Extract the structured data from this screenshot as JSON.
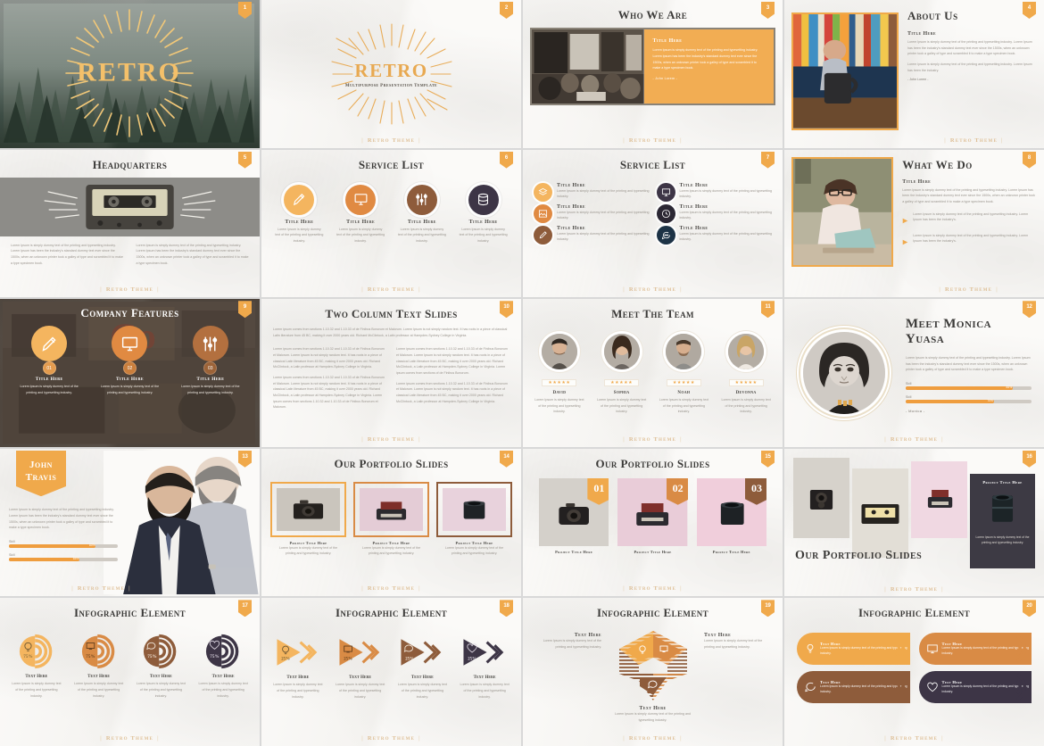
{
  "meta": {
    "watermark": "Retro Theme",
    "brand_orange": "#f0a94b",
    "brand_dark": "#3d3546",
    "brand_brown": "#8e5c3b",
    "brand_tan": "#d98b45"
  },
  "common": {
    "title_here": "Title Here",
    "text_here": "Text Here",
    "lorem_short": "Lorem Ipsum is simply dummy text of the printing and typesetting industry.",
    "lorem_medium": "Lorem Ipsum is simply dummy text of the printing and typesetting industry. Lorem Ipsum has been the industry's standard dummy text ever since the 1500s, when an unknown printer took a galley of type and scrambled it to make a type specimen book.",
    "lorem_long": "Lorem ipsum comes from sections 1.10.32 and 1.10.33 of de Finibus Bonorum et Malorum. Lorem Ipsum is not simply random text. It has roots in a piece of classical Latin literature from 45 BC, making it over 2000 years old. Richard McClintock, a Latin professor at Hampden-Sydney College in Virginia.",
    "signature": "- John Lorem -",
    "percent": "75%"
  },
  "slides": [
    {
      "number": "1",
      "name": "cover-slide",
      "title": "RETRO",
      "subtitle": ""
    },
    {
      "number": "2",
      "name": "cover-light-slide",
      "title": "RETRO",
      "subtitle": "Multipurpose Presentation Template"
    },
    {
      "number": "3",
      "name": "who-we-are-slide",
      "title": "Who We Are",
      "panel_title": "Title Here",
      "panel_body": "Lorem Ipsum is simply dummy text of the printing and typesetting industry. Lorem Ipsum has been the industry's standard dummy text ever since the 1500s, when an unknown printer took a galley of type and scrambled it to make a type specimen book.",
      "panel_sig": "- John Lorem -"
    },
    {
      "number": "4",
      "name": "about-us-slide",
      "title": "About Us",
      "body_title": "Title Here",
      "body_p1": "Lorem Ipsum is simply dummy text of the printing and typesetting industry. Lorem Ipsum has been the industry's standard dummy text ever since the 1500s, when an unknown printer took a galley of type and scrambled it to make a type specimen book.",
      "body_p2": "Lorem Ipsum is simply dummy text of the printing and typesetting industry. Lorem Ipsum has been the industry.",
      "body_sig": "- John Lorem -"
    },
    {
      "number": "5",
      "name": "headquarters-slide",
      "title": "Headquarters",
      "col1": "Lorem Ipsum is simply dummy text of the printing and typesetting industry. Lorem Ipsum has been the industry's standard dummy text ever since the 1500s, when an unknown printer took a galley of type and scrambled it to make a type specimen book.",
      "col2": "Lorem Ipsum is simply dummy text of the printing and typesetting industry. Lorem Ipsum has been the industry's standard dummy text ever since the 1500s, when an unknown printer took a galley of type and scrambled it to make a type specimen book."
    },
    {
      "number": "6",
      "name": "service-list-circles-slide",
      "title": "Service List",
      "items": [
        {
          "label": "Title Here",
          "icon": "pencil-icon",
          "color": "#f4b55f",
          "body": "Lorem Ipsum is simply dummy text of the printing and typesetting industry."
        },
        {
          "label": "Title Here",
          "icon": "monitor-icon",
          "color": "#e08a42",
          "body": "Lorem Ipsum is simply dummy text of the printing and typesetting industry."
        },
        {
          "label": "Title Here",
          "icon": "sliders-icon",
          "color": "#8e5c3b",
          "body": "Lorem Ipsum is simply dummy text of the printing and typesetting industry."
        },
        {
          "label": "Title Here",
          "icon": "database-icon",
          "color": "#3d3546",
          "body": "Lorem Ipsum is simply dummy text of the printing and typesetting industry."
        }
      ]
    },
    {
      "number": "7",
      "name": "service-list-two-column-slide",
      "title": "Service List",
      "items": [
        {
          "label": "Title Here",
          "icon": "layers-icon",
          "color": "#f4b55f",
          "body": "Lorem Ipsum is simply dummy text of the printing and typesetting industry."
        },
        {
          "label": "Title Here",
          "icon": "presentation-icon",
          "color": "#3d3546",
          "body": "Lorem Ipsum is simply dummy text of the printing and typesetting industry."
        },
        {
          "label": "Title Here",
          "icon": "image-icon",
          "color": "#e08a42",
          "body": "Lorem Ipsum is simply dummy text of the printing and typesetting industry."
        },
        {
          "label": "Title Here",
          "icon": "clock-icon",
          "color": "#2b2733",
          "body": "Lorem Ipsum is simply dummy text of the printing and typesetting industry."
        },
        {
          "label": "Title Here",
          "icon": "edit-icon",
          "color": "#8e5c3b",
          "body": "Lorem Ipsum is simply dummy text of the printing and typesetting industry."
        },
        {
          "label": "Title Here",
          "icon": "chat-icon",
          "color": "#1d3346",
          "body": "Lorem Ipsum is simply dummy text of the printing and typesetting industry."
        }
      ]
    },
    {
      "number": "8",
      "name": "what-we-do-slide",
      "title": "What We Do",
      "body_title": "Title Here",
      "body_p": "Lorem Ipsum is simply dummy text of the printing and typesetting industry. Lorem Ipsum has been the industry's standard dummy text ever since the 1500s, when an unknown printer took a galley of type and scrambled it to make a type specimen book.",
      "bullets": [
        "Lorem Ipsum is simply dummy text of the printing and typesetting industry. Lorem Ipsum has been the industry's.",
        "Lorem Ipsum is simply dummy text of the printing and typesetting industry. Lorem Ipsum has been the industry's."
      ]
    },
    {
      "number": "9",
      "name": "company-features-slide",
      "title": "Company Features",
      "items": [
        {
          "label": "Title Here",
          "icon": "pencil-icon",
          "color": "#f4b55f",
          "num": "01",
          "body": "Lorem Ipsum is simply dummy text of the printing and typesetting industry."
        },
        {
          "label": "Title Here",
          "icon": "monitor-icon",
          "color": "#e08a42",
          "num": "02",
          "body": "Lorem Ipsum is simply dummy text of the printing and typesetting industry."
        },
        {
          "label": "Title Here",
          "icon": "sliders-icon",
          "color": "#b3703f",
          "num": "03",
          "body": "Lorem Ipsum is simply dummy text of the printing and typesetting industry."
        }
      ]
    },
    {
      "number": "10",
      "name": "two-column-text-slide",
      "title": "Two Column Text Slides",
      "intro": "Lorem ipsum comes from sections 1.10.32 and 1.10.33 of de Finibus Bonorum et Malorum. Lorem Ipsum is not simply random text. It has roots in a piece of classical Latin literature from 45 BC, making it over 2000 years old. Richard McClintock, a Latin professor at Hampden-Sydney College in Virginia.",
      "col1_p1": "Lorem ipsum comes from sections 1.10.32 and 1.10.33 of de Finibus Bonorum et Malorum. Lorem Ipsum is not simply random text. It has roots in a piece of classical Latin literature from 45 BC, making it over 2000 years old. Richard McClintock, a Latin professor at Hampden-Sydney College in Virginia.",
      "col1_p2": "Lorem ipsum comes from sections 1.10.32 and 1.10.33 of de Finibus Bonorum et Malorum. Lorem Ipsum is not simply random text. It has roots in a piece of classical Latin literature from 45 BC, making it over 2000 years old. Richard McClintock, a Latin professor at Hampden-Sydney College in Virginia. Lorem ipsum comes from sections 1.10.32 and 1.10.33 of de Finibus Bonorum et Malorum.",
      "col2_p1": "Lorem ipsum comes from sections 1.10.32 and 1.10.33 of de Finibus Bonorum et Malorum. Lorem Ipsum is not simply random text. It has roots in a piece of classical Latin literature from 45 BC, making it over 2000 years old. Richard McClintock, a Latin professor at Hampden-Sydney College in Virginia. Lorem ipsum comes from sections of de Finibus Bonorum.",
      "col2_p2": "Lorem ipsum comes from sections 1.10.32 and 1.10.33 of de Finibus Bonorum et Malorum. Lorem Ipsum is not simply random text. It has roots in a piece of classical Latin literature from 45 BC, making it over 2000 years old. Richard McClintock, a Latin professor at Hampden-Sydney College in Virginia."
    },
    {
      "number": "11",
      "name": "meet-the-team-slide",
      "title": "Meet The Team",
      "members": [
        {
          "name": "David",
          "stars": "★★★★★",
          "body": "Lorem Ipsum is simply dummy text of the printing and typesetting industry."
        },
        {
          "name": "Sophia",
          "stars": "★★★★★",
          "body": "Lorem Ipsum is simply dummy text of the printing and typesetting industry."
        },
        {
          "name": "Noah",
          "stars": "★★★★★",
          "body": "Lorem Ipsum is simply dummy text of the printing and typesetting industry."
        },
        {
          "name": "Devonna",
          "stars": "★★★★★",
          "body": "Lorem Ipsum is simply dummy text of the printing and typesetting industry."
        }
      ]
    },
    {
      "number": "12",
      "name": "meet-monica-yuasa-slide",
      "title": "Meet Monica Yuasa",
      "body": "Lorem Ipsum is simply dummy text of the printing and typesetting industry. Lorem Ipsum has been the industry's standard dummy text ever since the 1500s, when an unknown printer took a galley of type and scrambled it to make a type specimen book.",
      "skills": [
        {
          "label": "Skill",
          "value": "85%",
          "pct": 85
        },
        {
          "label": "Skill",
          "value": "70%",
          "pct": 70
        }
      ],
      "signature": "- Monica -"
    },
    {
      "number": "13",
      "name": "john-travis-slide",
      "name_line1": "John",
      "name_line2": "Travis",
      "body": "Lorem Ipsum is simply dummy text of the printing and typesetting industry. Lorem Ipsum has been the industry's standard dummy text ever since the 1500s, when an unknown printer took a galley of type and scrambled it to make a type specimen book.",
      "skills": [
        {
          "label": "Skill",
          "value": "80%",
          "pct": 80
        },
        {
          "label": "Skill",
          "value": "65%",
          "pct": 65
        }
      ]
    },
    {
      "number": "14",
      "name": "portfolio-three-up-slide",
      "title": "Our Portfolio Slides",
      "items": [
        {
          "caption": "Project Title Here",
          "body": "Lorem Ipsum is simply dummy text of the printing and typesetting industry."
        },
        {
          "caption": "Project Title Here",
          "body": "Lorem Ipsum is simply dummy text of the printing and typesetting industry."
        },
        {
          "caption": "Project Title Here",
          "body": "Lorem Ipsum is simply dummy text of the printing and typesetting industry."
        }
      ]
    },
    {
      "number": "15",
      "name": "portfolio-numbered-slide",
      "title": "Our Portfolio Slides",
      "items": [
        {
          "num": "01",
          "caption": "Project Title Here",
          "color": "#f0a94b"
        },
        {
          "num": "02",
          "caption": "Project Title Here",
          "color": "#d98b45"
        },
        {
          "num": "03",
          "caption": "Project Title Here",
          "color": "#8e5c3b"
        }
      ]
    },
    {
      "number": "16",
      "name": "portfolio-collage-slide",
      "title": "Our Portfolio Slides",
      "card_title": "Project Title Here",
      "card_body": "Lorem Ipsum is simply dummy text of the printing and typesetting industry."
    },
    {
      "number": "17",
      "name": "infographic-radial-slide",
      "title": "Infographic Element",
      "items": [
        {
          "label": "Text Here",
          "percent": "75%",
          "pct": 75,
          "icon": "bulb-icon",
          "color": "#f4b55f",
          "body": "Lorem Ipsum is simply dummy text of the printing and typesetting industry."
        },
        {
          "label": "Text Here",
          "percent": "75%",
          "pct": 75,
          "icon": "monitor-icon",
          "color": "#d98b45",
          "body": "Lorem Ipsum is simply dummy text of the printing and typesetting industry."
        },
        {
          "label": "Text Here",
          "percent": "75%",
          "pct": 75,
          "icon": "chat-icon",
          "color": "#8e5c3b",
          "body": "Lorem Ipsum is simply dummy text of the printing and typesetting industry."
        },
        {
          "label": "Text Here",
          "percent": "75%",
          "pct": 75,
          "icon": "heart-icon",
          "color": "#3d3546",
          "body": "Lorem Ipsum is simply dummy text of the printing and typesetting industry."
        }
      ]
    },
    {
      "number": "18",
      "name": "infographic-arrow-slide",
      "title": "Infographic Element",
      "items": [
        {
          "label": "Text Here",
          "percent": "25%",
          "icon": "bulb-icon",
          "color": "#f4b55f",
          "body": "Lorem Ipsum is simply dummy text of the printing and typesetting industry."
        },
        {
          "label": "Text Here",
          "percent": "25%",
          "icon": "monitor-icon",
          "color": "#d98b45",
          "body": "Lorem Ipsum is simply dummy text of the printing and typesetting industry."
        },
        {
          "label": "Text Here",
          "percent": "25%",
          "icon": "chat-icon",
          "color": "#8e5c3b",
          "body": "Lorem Ipsum is simply dummy text of the printing and typesetting industry."
        },
        {
          "label": "Text Here",
          "percent": "25%",
          "icon": "heart-icon",
          "color": "#3d3546",
          "body": "Lorem Ipsum is simply dummy text of the printing and typesetting industry."
        }
      ]
    },
    {
      "number": "19",
      "name": "infographic-hexagon-slide",
      "title": "Infographic Element",
      "items": [
        {
          "label": "Text Here",
          "icon": "bulb-icon",
          "color": "#f0a94b",
          "body": "Lorem Ipsum is simply dummy text of the printing and typesetting industry."
        },
        {
          "label": "Text Here",
          "icon": "monitor-icon",
          "color": "#d98b45",
          "body": "Lorem Ipsum is simply dummy text of the printing and typesetting industry."
        },
        {
          "label": "Text Here",
          "icon": "chat-icon",
          "color": "#8e5c3b",
          "body": "Lorem Ipsum is simply dummy text of the printing and typesetting industry."
        }
      ]
    },
    {
      "number": "20",
      "name": "infographic-banner-slide",
      "title": "Infographic Element",
      "items": [
        {
          "label": "Text Here",
          "icon": "bulb-icon",
          "color": "#f0a94b",
          "body": "Lorem Ipsum is simply dummy text of the printing and typesetting industry."
        },
        {
          "label": "Text Here",
          "icon": "monitor-icon",
          "color": "#d98b45",
          "body": "Lorem Ipsum is simply dummy text of the printing and typesetting industry."
        },
        {
          "label": "Text Here",
          "icon": "chat-icon",
          "color": "#8e5c3b",
          "body": "Lorem Ipsum is simply dummy text of the printing and typesetting industry."
        },
        {
          "label": "Text Here",
          "icon": "heart-icon",
          "color": "#3d3546",
          "body": "Lorem Ipsum is simply dummy text of the printing and typesetting industry."
        }
      ]
    }
  ]
}
